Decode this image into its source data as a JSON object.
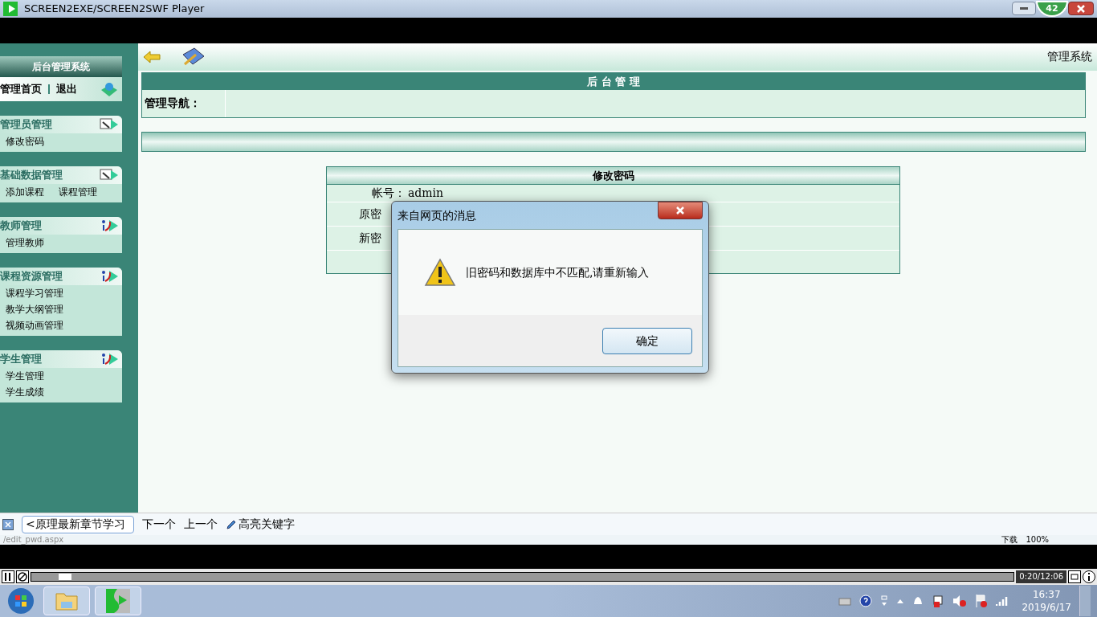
{
  "window": {
    "title": "SCREEN2EXE/SCREEN2SWF Player",
    "badge": "42"
  },
  "sidebar": {
    "title": "后台管理系统",
    "top_links": [
      "管理首页",
      "退出"
    ],
    "sections": [
      {
        "title": "管理员管理",
        "kind": "note",
        "items": [
          "修改密码"
        ]
      },
      {
        "title": "基础数据管理",
        "kind": "note",
        "items": [
          "添加课程",
          "课程管理"
        ],
        "inline": true
      },
      {
        "title": "教师管理",
        "kind": "info",
        "items": [
          "管理教师"
        ]
      },
      {
        "title": "课程资源管理",
        "kind": "info",
        "items": [
          "课程学习管理",
          "教学大纲管理",
          "视频动画管理"
        ]
      },
      {
        "title": "学生管理",
        "kind": "info",
        "items": [
          "学生管理",
          "学生成绩"
        ]
      }
    ]
  },
  "toolbar": {
    "right_label": "管理系统"
  },
  "panel": {
    "title": "后 台 管 理",
    "nav_label": "管理导航："
  },
  "form": {
    "title": "修改密码",
    "rows": [
      {
        "label": "帐号：",
        "value": "admin"
      },
      {
        "label": "原密"
      },
      {
        "label": "新密"
      }
    ]
  },
  "dialog": {
    "title": "来自网页的消息",
    "message": "旧密码和数据库中不匹配,请重新输入",
    "ok": "确定"
  },
  "find_bar": {
    "query": "<原理最新章节学习",
    "next": "下一个",
    "prev": "上一个",
    "highlight": "高亮关键字"
  },
  "status_bar": {
    "url": "/edit_pwd.aspx",
    "download": "下载",
    "zoom": "100%"
  },
  "player": {
    "level": 0.028,
    "time": "0:20/12:06"
  },
  "taskbar": {
    "time": "16:37",
    "date": "2019/6/17"
  }
}
